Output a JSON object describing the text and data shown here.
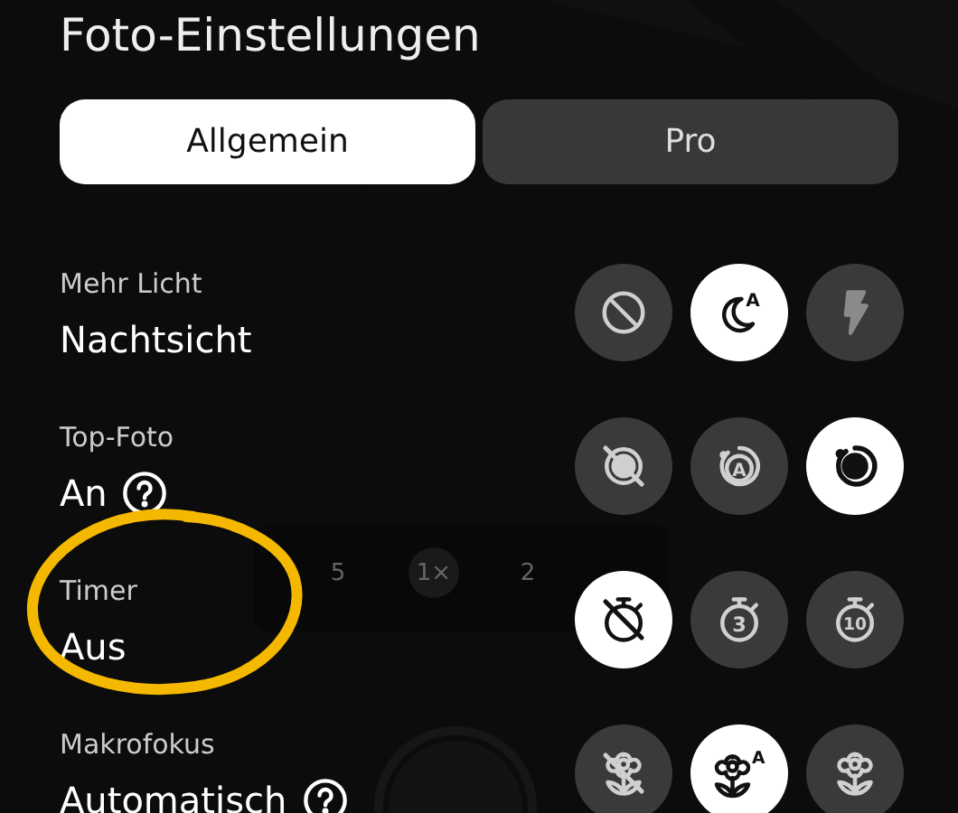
{
  "title": "Foto-Einstellungen",
  "tabs": [
    {
      "label": "Allgemein",
      "selected": true
    },
    {
      "label": "Pro",
      "selected": false
    }
  ],
  "background": {
    "kind": "picture",
    "zoom_levels": [
      {
        "label": "5",
        "selected": false
      },
      {
        "label": "1×",
        "selected": true
      },
      {
        "label": "2",
        "selected": false
      }
    ]
  },
  "settings": [
    {
      "caption": "Mehr Licht",
      "value": "Nachtsicht",
      "help": false,
      "options": [
        {
          "selected": false,
          "disabled": false
        },
        {
          "selected": true,
          "disabled": false,
          "label": "A"
        },
        {
          "selected": false,
          "disabled": true
        }
      ]
    },
    {
      "caption": "Top-Foto",
      "value": "An",
      "help": true,
      "options": [
        {
          "selected": false,
          "disabled": false
        },
        {
          "selected": false,
          "disabled": false,
          "label": "A"
        },
        {
          "selected": true,
          "disabled": false
        }
      ]
    },
    {
      "caption": "Timer",
      "value": "Aus",
      "help": false,
      "highlighted": true,
      "options": [
        {
          "selected": true,
          "disabled": false
        },
        {
          "selected": false,
          "disabled": false,
          "label": "3"
        },
        {
          "selected": false,
          "disabled": false,
          "label": "10"
        }
      ]
    },
    {
      "caption": "Makrofokus",
      "value": "Automatisch",
      "help": true,
      "options": [
        {
          "selected": false,
          "disabled": false
        },
        {
          "selected": true,
          "disabled": false,
          "label": "A"
        },
        {
          "selected": false,
          "disabled": false
        }
      ]
    }
  ]
}
